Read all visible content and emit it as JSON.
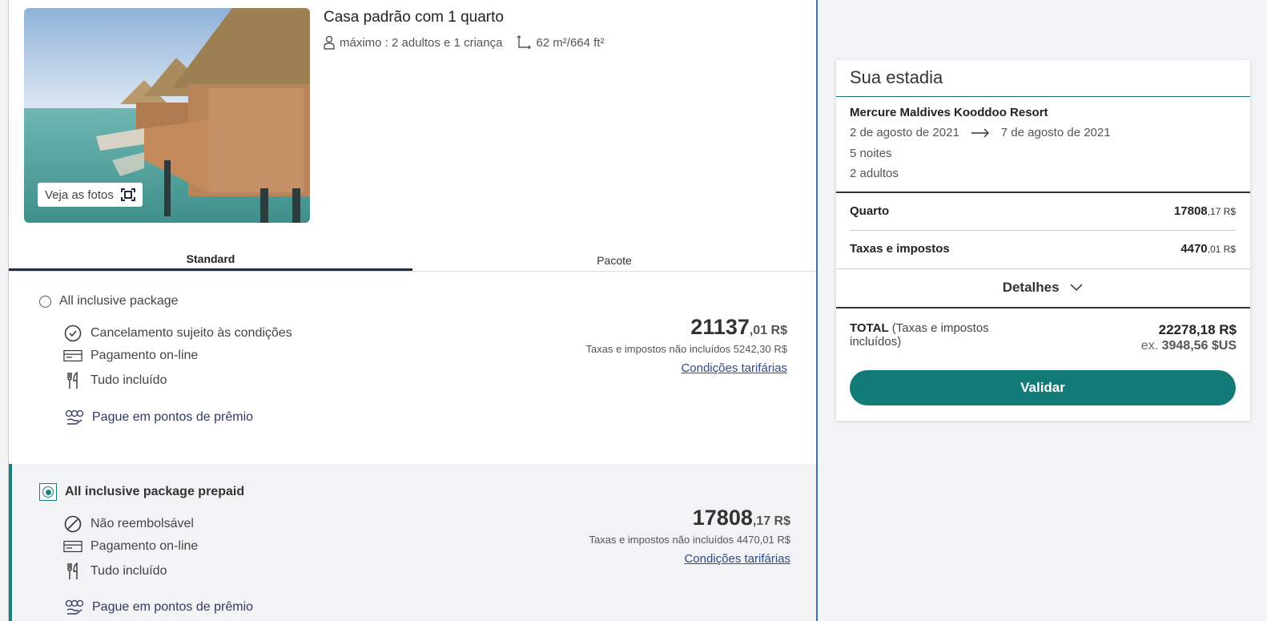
{
  "room": {
    "title": "Casa padrão com 1 quarto",
    "capacity": "máximo : 2 adultos e 1 criança",
    "size": "62 m²/664 ft²",
    "photos_label": "Veja as fotos"
  },
  "tabs": [
    {
      "label": "Standard",
      "active": true
    },
    {
      "label": "Pacote",
      "active": false
    }
  ],
  "rates": [
    {
      "name": "All inclusive package",
      "selected": false,
      "features": [
        {
          "icon": "clock-icon",
          "label": "Cancelamento sujeito às condições"
        },
        {
          "icon": "credit-card-icon",
          "label": "Pagamento on-line"
        },
        {
          "icon": "fork-knife-icon",
          "label": "Tudo incluído"
        }
      ],
      "points_label": "Pague em pontos de prêmio",
      "price_int": "21137",
      "price_cents": ",01 R$",
      "tax_note": "Taxas e impostos não incluídos 5242,30 R$",
      "conditions_label": "Condições tarifárias"
    },
    {
      "name": "All inclusive package prepaid",
      "selected": true,
      "features": [
        {
          "icon": "no-entry-icon",
          "label": "Não reembolsável"
        },
        {
          "icon": "credit-card-icon",
          "label": "Pagamento on-line"
        },
        {
          "icon": "fork-knife-icon",
          "label": "Tudo incluído"
        }
      ],
      "points_label": "Pague em pontos de prêmio",
      "price_int": "17808",
      "price_cents": ",17 R$",
      "tax_note": "Taxas e impostos não incluídos 4470,01 R$",
      "conditions_label": "Condições tarifárias"
    }
  ],
  "stay": {
    "title": "Sua estadia",
    "hotel": "Mercure Maldives Kooddoo Resort",
    "date_from": "2 de agosto de 2021",
    "date_to": "7 de agosto de 2021",
    "nights": "5 noites",
    "guests": "2 adultos",
    "room_label": "Quarto",
    "room_int": "17808",
    "room_cents": ",17 R$",
    "tax_label": "Taxas e impostos",
    "tax_int": "4470",
    "tax_cents": ",01 R$",
    "details_label": "Detalhes",
    "total_label": "TOTAL",
    "total_sub": "(Taxas e impostos incluídos)",
    "total_amount": "22278,18 R$",
    "total_ex_prefix": "ex.",
    "total_ex_amount": "3948,56 $US",
    "validate_label": "Validar"
  },
  "colors": {
    "accent": "#127b78",
    "tab_underline": "#1f2a44",
    "link": "#2f4a8a"
  }
}
